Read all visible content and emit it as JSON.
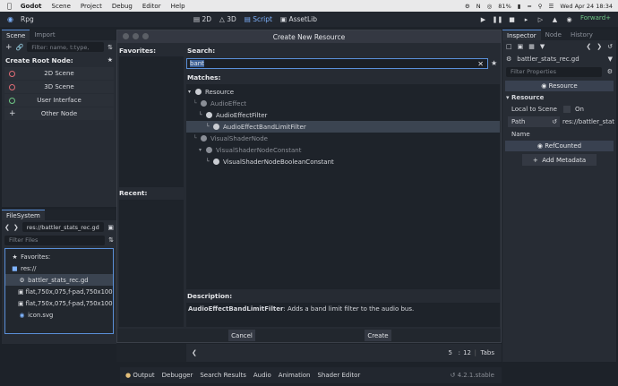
{
  "menubar": {
    "apple_icon": "apple-icon",
    "app_name": "Godot",
    "items": [
      "Scene",
      "Project",
      "Debug",
      "Editor",
      "Help"
    ],
    "battery": "81%",
    "datetime": "Wed Apr 24  18:34"
  },
  "titlebar": {
    "project": "Rpg",
    "workspaces": [
      "2D",
      "3D",
      "Script",
      "AssetLib"
    ],
    "active_workspace": "Script",
    "renderer": "Forward+"
  },
  "scene_dock": {
    "tabs": [
      "Scene",
      "Import"
    ],
    "filter_placeholder": "Filter: name, t:type,",
    "create_root_label": "Create Root Node:",
    "root_buttons": [
      {
        "label": "2D Scene",
        "color": "#e06c75"
      },
      {
        "label": "3D Scene",
        "color": "#e06c75"
      },
      {
        "label": "User Interface",
        "color": "#6fc785"
      },
      {
        "label": "Other Node",
        "color": "#d4d6db"
      }
    ]
  },
  "filesystem_dock": {
    "tab": "FileSystem",
    "path": "res://battler_stats_rec.gd",
    "filter_placeholder": "Filter Files",
    "items": [
      {
        "label": "Favorites:",
        "icon": "star-icon"
      },
      {
        "label": "res://",
        "icon": "folder-icon"
      },
      {
        "label": "battler_stats_rec.gd",
        "icon": "gear-icon"
      },
      {
        "label": "flat,750x,075,f-pad,750x100...",
        "icon": "image-icon"
      },
      {
        "label": "flat,750x,075,f-pad,750x100...",
        "icon": "image-icon"
      },
      {
        "label": "icon.svg",
        "icon": "godot-icon"
      }
    ]
  },
  "dialog": {
    "title": "Create New Resource",
    "favorites_label": "Favorites:",
    "recent_label": "Recent:",
    "search_label": "Search:",
    "search_value": "bant",
    "matches_label": "Matches:",
    "tree": [
      {
        "label": "Resource",
        "level": 0,
        "dim": false
      },
      {
        "label": "AudioEffect",
        "level": 1,
        "dim": true
      },
      {
        "label": "AudioEffectFilter",
        "level": 2,
        "dim": false
      },
      {
        "label": "AudioEffectBandLimitFilter",
        "level": 3,
        "dim": false,
        "selected": true
      },
      {
        "label": "VisualShaderNode",
        "level": 1,
        "dim": true
      },
      {
        "label": "VisualShaderNodeConstant",
        "level": 2,
        "dim": true
      },
      {
        "label": "VisualShaderNodeBooleanConstant",
        "level": 3,
        "dim": false
      }
    ],
    "description_label": "Description:",
    "description_name": "AudioEffectBandLimitFilter",
    "description_text": ": Adds a band limit filter to the audio bus.",
    "cancel": "Cancel",
    "create": "Create"
  },
  "inspector": {
    "tabs": [
      "Inspector",
      "Node",
      "History"
    ],
    "file": "battler_stats_rec.gd",
    "filter_placeholder": "Filter Properties",
    "resource_header": "Resource",
    "resource_section": "Resource",
    "local_to_scene": "Local to Scene",
    "on_label": "On",
    "path_label": "Path",
    "path_value": "res://battler_stat",
    "name_label": "Name",
    "refcounted": "RefCounted",
    "add_metadata": "Add Metadata"
  },
  "script_status": {
    "line": "5",
    "col": "12",
    "indent": "Tabs"
  },
  "bottom_panel": {
    "tabs": [
      "Output",
      "Debugger",
      "Search Results",
      "Audio",
      "Animation",
      "Shader Editor"
    ],
    "version": "4.2.1.stable"
  }
}
